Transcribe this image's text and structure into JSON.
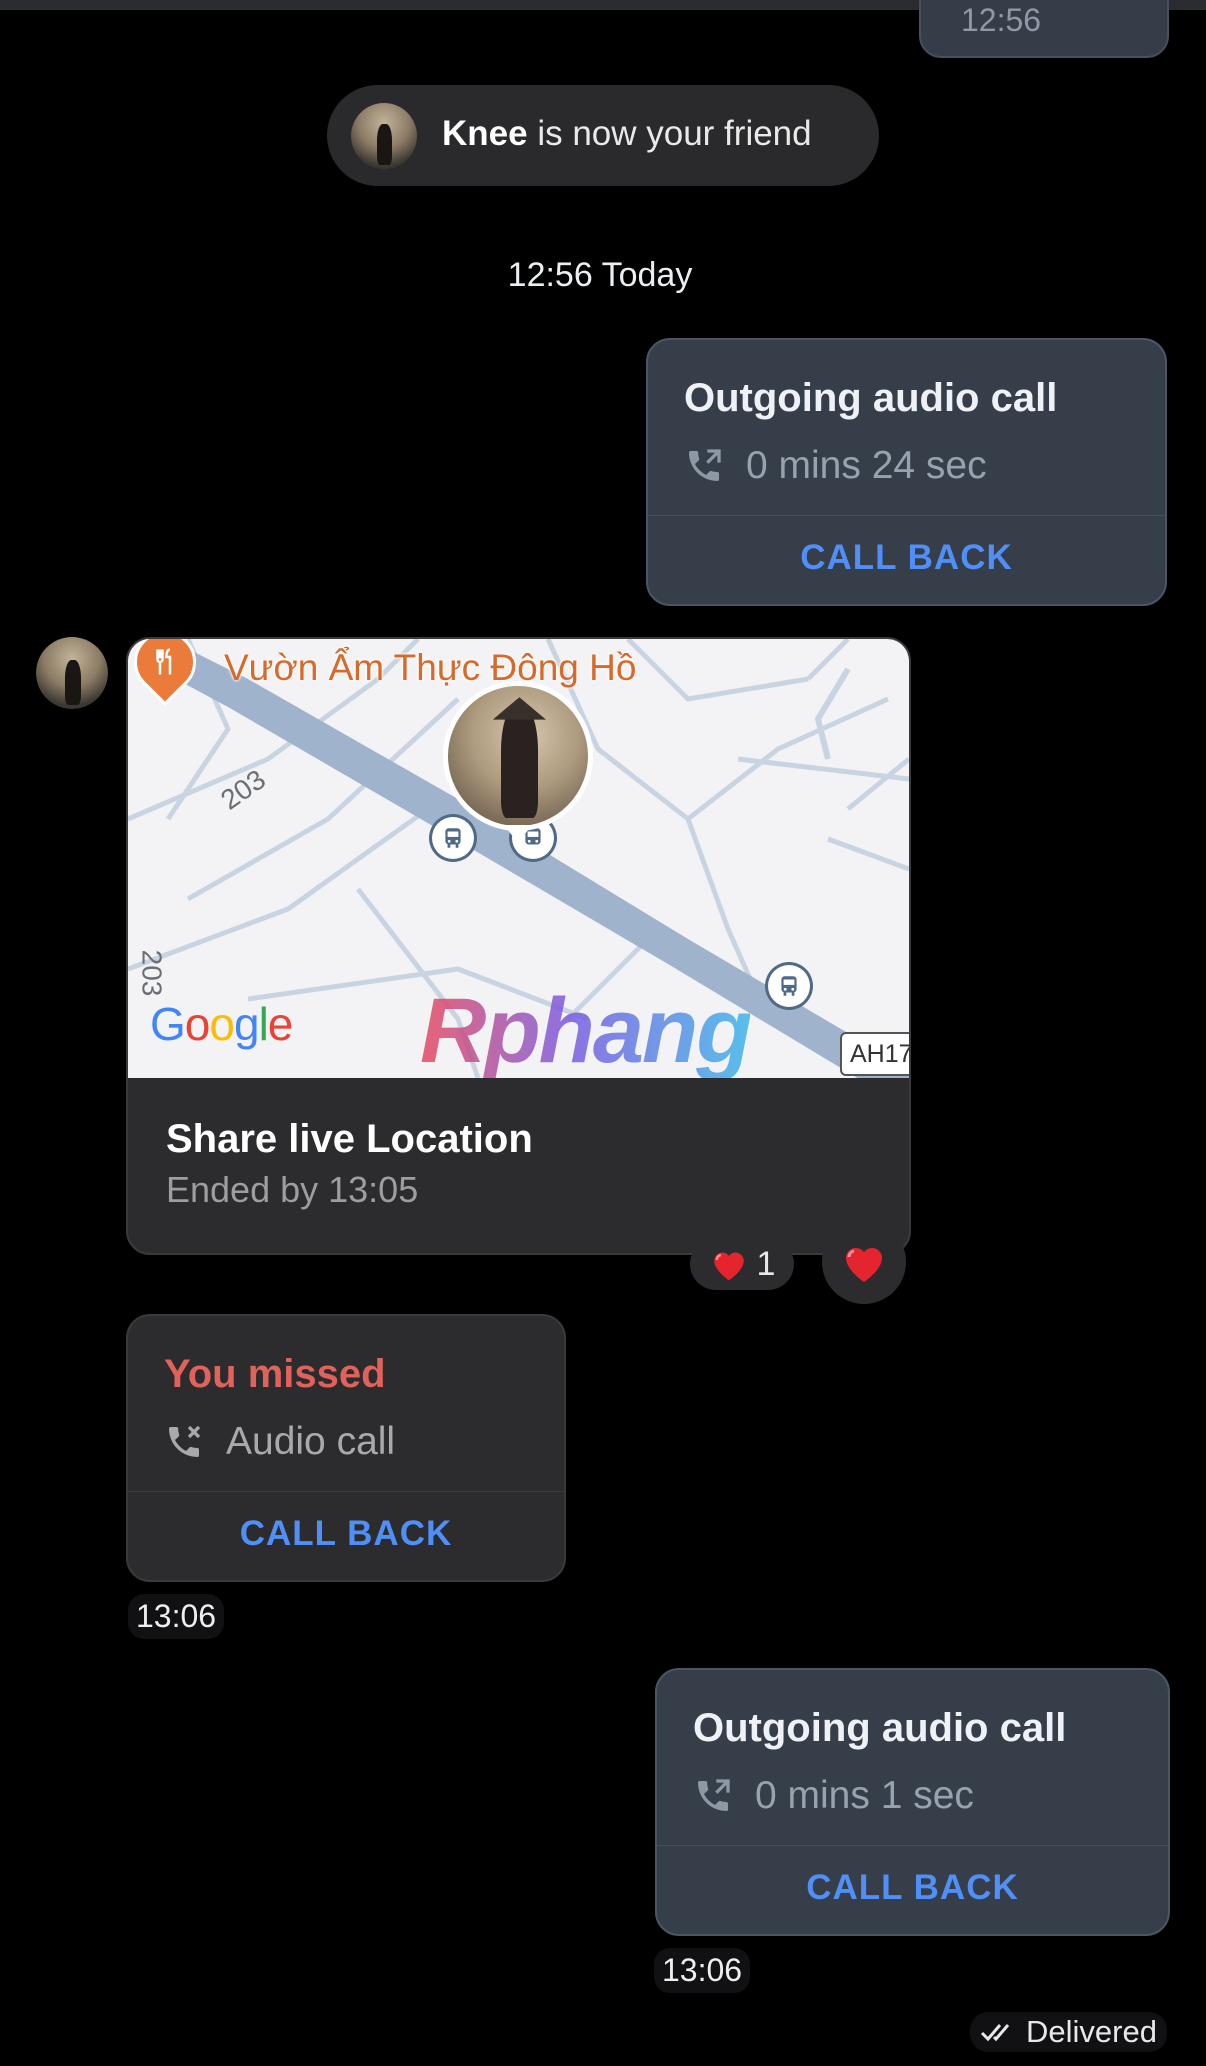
{
  "previous_message": {
    "time": "12:56"
  },
  "friend_notice": {
    "name": "Knee",
    "text": " is now your friend"
  },
  "date_divider": "12:56 Today",
  "outgoing_call_1": {
    "title": "Outgoing audio call",
    "duration": "0 mins 24 sec",
    "action": "CALL BACK"
  },
  "location_message": {
    "poi_name": "Vườn Ẩm Thực Đông Hồ",
    "road_label_1": "203",
    "road_label_2": "203",
    "map_provider": "Google",
    "watermark": "Rphang",
    "highway_shield": "AH17",
    "title": "Share live Location",
    "subtitle": "Ended by 13:05",
    "reactions": {
      "heart_count": "1"
    }
  },
  "missed_call": {
    "title": "You missed",
    "label": "Audio call",
    "action": "CALL BACK",
    "time": "13:06"
  },
  "outgoing_call_2": {
    "title": "Outgoing audio call",
    "duration": "0 mins 1 sec",
    "action": "CALL BACK",
    "time": "13:06"
  },
  "status": {
    "delivered": "Delivered"
  },
  "colors": {
    "background": "#000000",
    "outgoing_bubble": "#363e4a",
    "incoming_bubble": "#2c2c2e",
    "accent": "#4f8ff7",
    "missed": "#e0625a",
    "poi": "#ea7b3a"
  },
  "icons": [
    "phone-outgoing-icon",
    "phone-missed-icon",
    "restaurant-icon",
    "bus-stop-icon",
    "heart-icon",
    "double-check-icon"
  ]
}
